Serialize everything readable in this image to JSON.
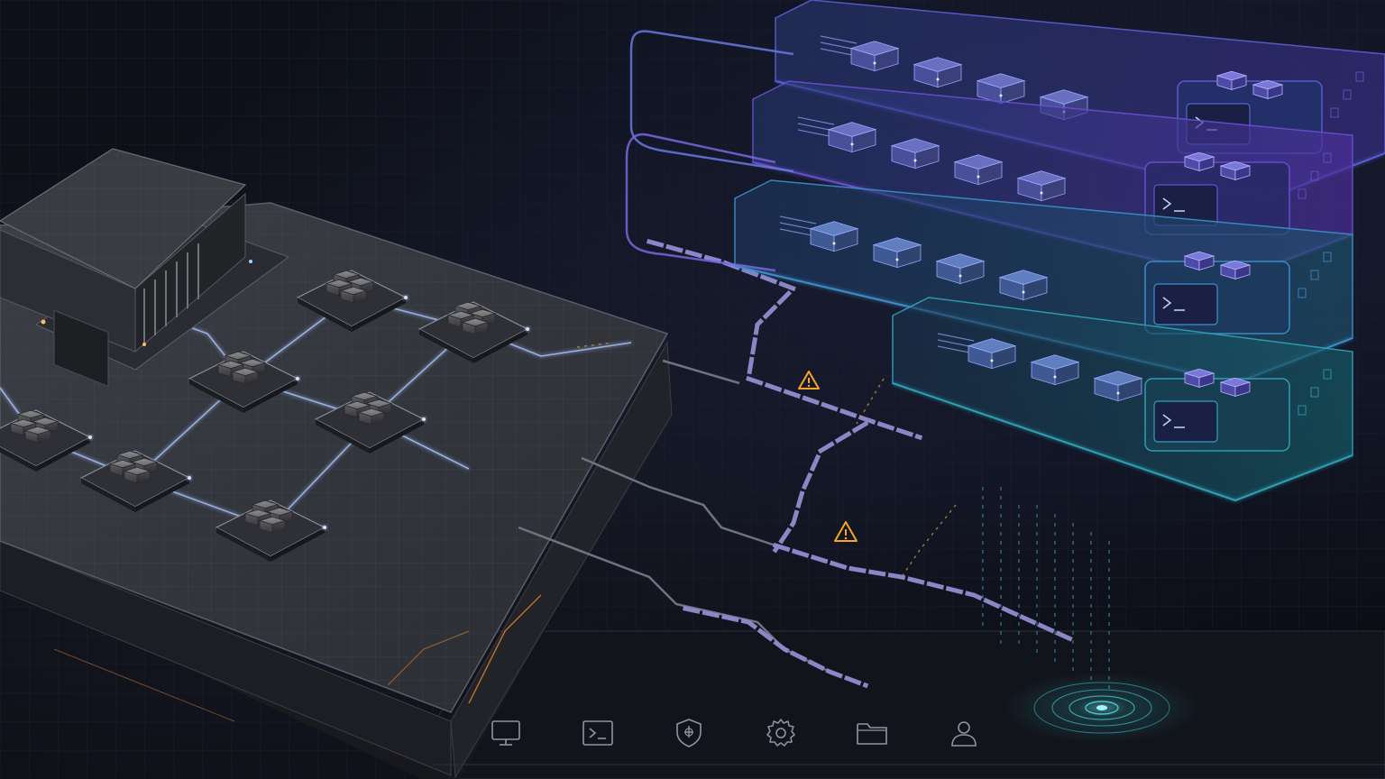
{
  "scene": {
    "grid_color": "#2b3140",
    "base_color": "#3a3d44",
    "base_edge": "#5a5f6a",
    "link_glow": "#a9c6ff",
    "warning_color": "#f5a623",
    "amber_trace": "#d9822b",
    "path_color": "#8a86c8",
    "rack_tiers": [
      {
        "accent": "#5a5fd6",
        "glass": "#23306a"
      },
      {
        "accent": "#6a4fd0",
        "glass": "#2a2a6a"
      },
      {
        "accent": "#3d8fc9",
        "glass": "#1d3a5e"
      },
      {
        "accent": "#2fa3b8",
        "glass": "#183f52"
      }
    ],
    "radar_color": "#3fd6e0"
  },
  "dock": {
    "items": [
      {
        "icon": "monitor-icon"
      },
      {
        "icon": "terminal-icon"
      },
      {
        "icon": "shield-icon"
      },
      {
        "icon": "gear-icon"
      },
      {
        "icon": "folder-icon"
      },
      {
        "icon": "user-icon"
      }
    ]
  }
}
